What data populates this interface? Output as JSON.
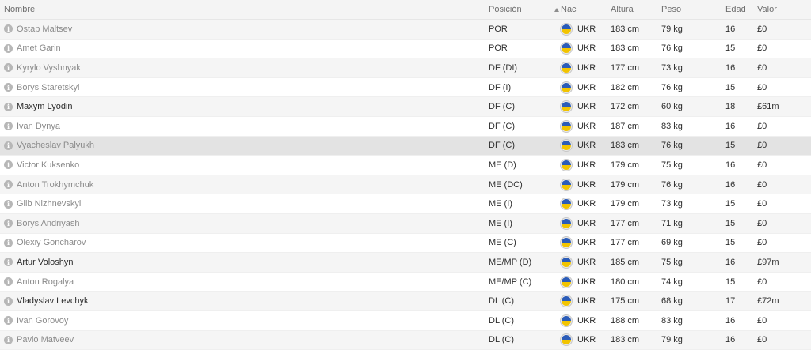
{
  "colors": {
    "flag_blue": "#2b5cb8",
    "flag_yellow": "#f2c400"
  },
  "header": {
    "name": "Nombre",
    "position": "Posición",
    "nationality": "Nac",
    "height": "Altura",
    "weight": "Peso",
    "age": "Edad",
    "value": "Valor"
  },
  "rows": [
    {
      "name": "Ostap Maltsev",
      "position": "POR",
      "flag": "ukraine-flag-icon",
      "nat": "UKR",
      "height": "183 cm",
      "weight": "79 kg",
      "age": "16",
      "value": "£0"
    },
    {
      "name": "Amet Garin",
      "position": "POR",
      "flag": "ukraine-flag-icon",
      "nat": "UKR",
      "height": "183 cm",
      "weight": "76 kg",
      "age": "15",
      "value": "£0"
    },
    {
      "name": "Kyrylo Vyshnyak",
      "position": "DF (DI)",
      "flag": "ukraine-flag-icon",
      "nat": "UKR",
      "height": "177 cm",
      "weight": "73 kg",
      "age": "16",
      "value": "£0"
    },
    {
      "name": "Borys Staretskyi",
      "position": "DF (I)",
      "flag": "ukraine-flag-icon",
      "nat": "UKR",
      "height": "182 cm",
      "weight": "76 kg",
      "age": "15",
      "value": "£0"
    },
    {
      "name": "Maxym Lyodin",
      "position": "DF (C)",
      "flag": "ukraine-flag-icon",
      "nat": "UKR",
      "height": "172 cm",
      "weight": "60 kg",
      "age": "18",
      "value": "£61m"
    },
    {
      "name": "Ivan Dynya",
      "position": "DF (C)",
      "flag": "ukraine-flag-icon",
      "nat": "UKR",
      "height": "187 cm",
      "weight": "83 kg",
      "age": "16",
      "value": "£0"
    },
    {
      "name": "Vyacheslav Palyukh",
      "position": "DF (C)",
      "flag": "ukraine-flag-icon",
      "nat": "UKR",
      "height": "183 cm",
      "weight": "76 kg",
      "age": "15",
      "value": "£0"
    },
    {
      "name": "Victor Kuksenko",
      "position": "ME (D)",
      "flag": "ukraine-flag-icon",
      "nat": "UKR",
      "height": "179 cm",
      "weight": "75 kg",
      "age": "16",
      "value": "£0"
    },
    {
      "name": "Anton Trokhymchuk",
      "position": "ME (DC)",
      "flag": "ukraine-flag-icon",
      "nat": "UKR",
      "height": "179 cm",
      "weight": "76 kg",
      "age": "16",
      "value": "£0"
    },
    {
      "name": "Glib Nizhnevskyi",
      "position": "ME (I)",
      "flag": "ukraine-flag-icon",
      "nat": "UKR",
      "height": "179 cm",
      "weight": "73 kg",
      "age": "15",
      "value": "£0"
    },
    {
      "name": "Borys Andriyash",
      "position": "ME (I)",
      "flag": "ukraine-flag-icon",
      "nat": "UKR",
      "height": "177 cm",
      "weight": "71 kg",
      "age": "15",
      "value": "£0"
    },
    {
      "name": "Olexiy Goncharov",
      "position": "ME (C)",
      "flag": "ukraine-flag-icon",
      "nat": "UKR",
      "height": "177 cm",
      "weight": "69 kg",
      "age": "15",
      "value": "£0"
    },
    {
      "name": "Artur Voloshyn",
      "position": "ME/MP (D)",
      "flag": "ukraine-flag-icon",
      "nat": "UKR",
      "height": "185 cm",
      "weight": "75 kg",
      "age": "16",
      "value": "£97m"
    },
    {
      "name": "Anton Rogalya",
      "position": "ME/MP (C)",
      "flag": "ukraine-flag-icon",
      "nat": "UKR",
      "height": "180 cm",
      "weight": "74 kg",
      "age": "15",
      "value": "£0"
    },
    {
      "name": "Vladyslav Levchyk",
      "position": "DL (C)",
      "flag": "ukraine-flag-icon",
      "nat": "UKR",
      "height": "175 cm",
      "weight": "68 kg",
      "age": "17",
      "value": "£72m"
    },
    {
      "name": "Ivan Gorovoy",
      "position": "DL (C)",
      "flag": "ukraine-flag-icon",
      "nat": "UKR",
      "height": "188 cm",
      "weight": "83 kg",
      "age": "16",
      "value": "£0"
    },
    {
      "name": "Pavlo Matveev",
      "position": "DL (C)",
      "flag": "ukraine-flag-icon",
      "nat": "UKR",
      "height": "183 cm",
      "weight": "79 kg",
      "age": "16",
      "value": "£0"
    }
  ]
}
